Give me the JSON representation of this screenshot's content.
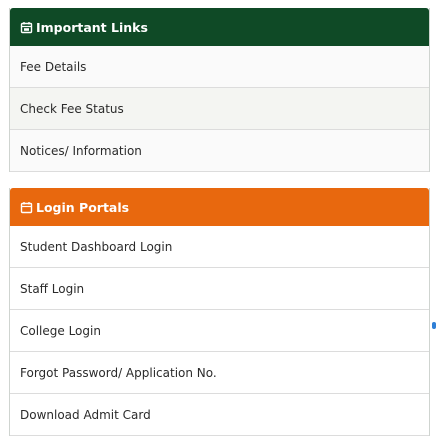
{
  "important_links": {
    "title": "Important Links",
    "icon": "calendar-icon",
    "header_color": "#0f4a26",
    "items": [
      {
        "label": "Fee Details"
      },
      {
        "label": "Check Fee Status"
      },
      {
        "label": "Notices/ Information"
      }
    ]
  },
  "login_portals": {
    "title": "Login Portals",
    "icon": "calendar-icon",
    "header_color": "#e8680e",
    "items": [
      {
        "label": "Student Dashboard Login"
      },
      {
        "label": "Staff Login"
      },
      {
        "label": "College Login"
      },
      {
        "label": "Forgot Password/ Application No."
      },
      {
        "label": "Download Admit Card"
      }
    ]
  }
}
